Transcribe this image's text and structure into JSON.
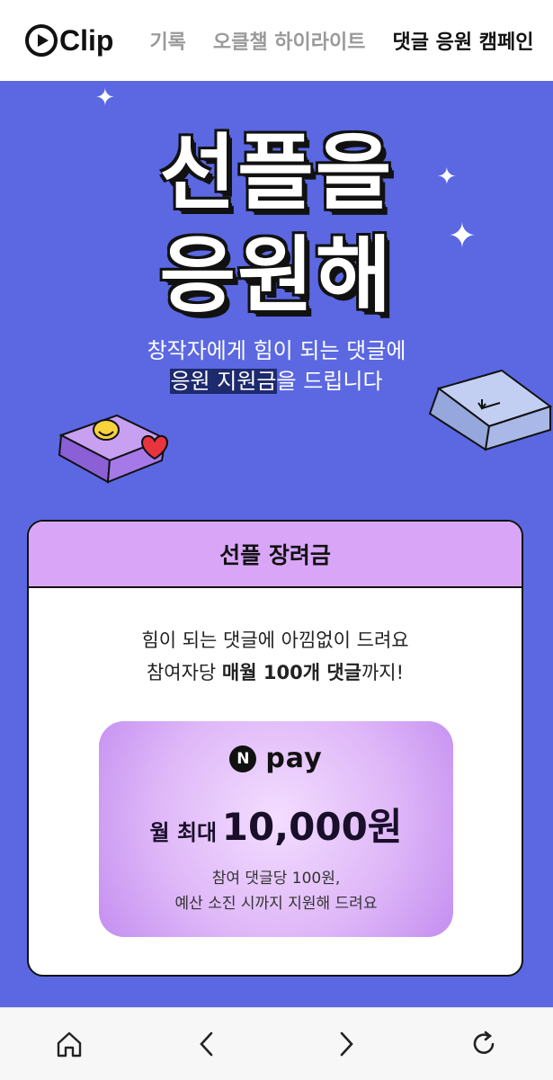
{
  "header": {
    "logo_text": "Clip",
    "nav": [
      {
        "label": "기록"
      },
      {
        "label": "오클챌 하이라이트"
      },
      {
        "label": "댓글 응원 캠페인"
      }
    ]
  },
  "hero": {
    "title_line1": "선플을",
    "title_line2": "응원해",
    "subtitle_line1": "창작자에게 힘이 되는 댓글에",
    "subtitle_highlight": "응원 지원금",
    "subtitle_line2_rest": "을 드립니다"
  },
  "card": {
    "header": "선플 장려금",
    "line1": "힘이 되는 댓글에 아낌없이 드려요",
    "line2_pre": "참여자당 ",
    "line2_bold": "매월 100개 댓글",
    "line2_post": "까지!",
    "pay": {
      "logo_letter": "N",
      "logo_word": "pay",
      "amount_prefix": "월 최대",
      "amount": "10,000원",
      "note1": "참여 댓글당 100원,",
      "note2": "예산 소진 시까지 지원해 드려요"
    }
  },
  "colors": {
    "background": "#5b68e2",
    "card_header": "#d9a6f7",
    "highlight": "#1e2a6e"
  },
  "bottom_nav": [
    "home-icon",
    "back-icon",
    "forward-icon",
    "refresh-icon"
  ]
}
